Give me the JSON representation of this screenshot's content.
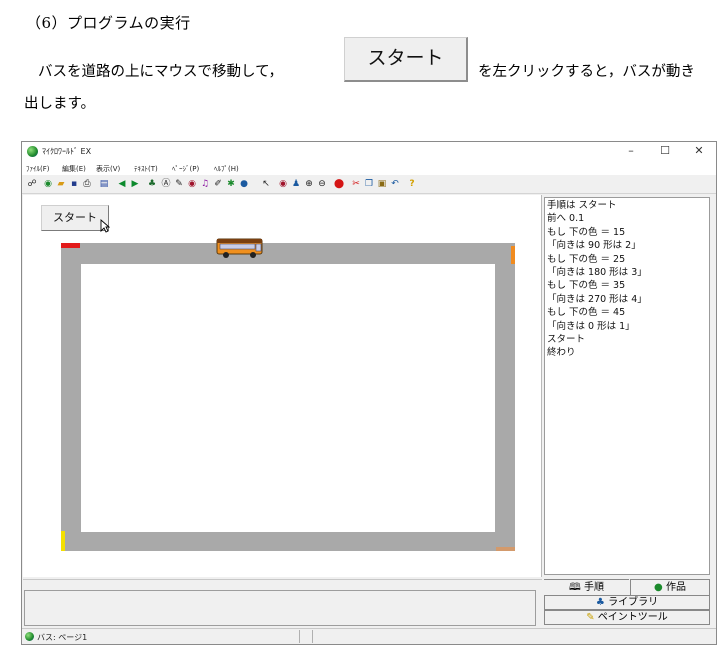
{
  "document": {
    "heading": "（6）プログラムの実行",
    "line1_before": "バスを道路の上にマウスで移動して，",
    "start_button_label": "スタート",
    "line1_after": "を左クリックすると，バスが動き",
    "line2": "出します。"
  },
  "window": {
    "title": "ﾏｲｸﾛﾜｰﾙﾄﾞ EX",
    "controls": {
      "minimize": "–",
      "maximize": "☐",
      "close": "✕"
    }
  },
  "menu": [
    "ﾌｧｲﾙ(F)",
    "編集(E)",
    "表示(V)",
    "ﾃｷｽﾄ(T)",
    "ﾍﾟｰｼﾞ(P)",
    "ﾍﾙﾌﾟ(H)"
  ],
  "canvas": {
    "start_button_label": "スタート",
    "bus_name": "バス"
  },
  "program": {
    "lines": [
      "手順は スタート",
      "前へ 0.1",
      "もし 下の色 ＝ 15",
      "「向きは 90 形は 2」",
      "もし 下の色 ＝ 25",
      "「向きは 180 形は 3」",
      "もし 下の色 ＝ 35",
      "「向きは 270 形は 4」",
      "もし 下の色 ＝ 45",
      "「向きは 0 形は 1」",
      "スタート",
      "終わり"
    ]
  },
  "tabs": {
    "tejun": "手順",
    "sakuhin": "作品"
  },
  "buttons": {
    "library": "ライブラリ",
    "paint_tool": "ペイントツール"
  },
  "status": {
    "text": "バス: ページ1"
  },
  "colors": {
    "road": "#a9a9a9",
    "corner_red": "#e21a1a",
    "corner_orange": "#f08b1f",
    "corner_yellow": "#f4e000",
    "corner_tan": "#d39a6c",
    "bus_body": "#f0901e"
  }
}
